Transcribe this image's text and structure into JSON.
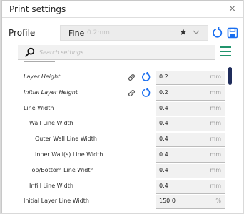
{
  "window": {
    "title": "Print settings",
    "close_symbol": "×"
  },
  "profile": {
    "label": "Profile",
    "selected_name": "Fine",
    "selected_sub": "0.2mm"
  },
  "search": {
    "placeholder": "Search settings",
    "value": ""
  },
  "settings": [
    {
      "label": "Layer Height",
      "italic": true,
      "indent": 0,
      "linked": true,
      "resettable": true,
      "value": "0.2",
      "unit": "mm"
    },
    {
      "label": "Initial Layer Height",
      "italic": true,
      "indent": 0,
      "linked": true,
      "resettable": true,
      "value": "0.2",
      "unit": "mm"
    },
    {
      "label": "Line Width",
      "italic": false,
      "indent": 0,
      "linked": false,
      "resettable": false,
      "value": "0.4",
      "unit": "mm"
    },
    {
      "label": "Wall Line Width",
      "italic": false,
      "indent": 1,
      "linked": false,
      "resettable": false,
      "value": "0.4",
      "unit": "mm"
    },
    {
      "label": "Outer Wall Line Width",
      "italic": false,
      "indent": 2,
      "linked": false,
      "resettable": false,
      "value": "0.4",
      "unit": "mm"
    },
    {
      "label": "Inner Wall(s) Line Width",
      "italic": false,
      "indent": 2,
      "linked": false,
      "resettable": false,
      "value": "0.4",
      "unit": "mm"
    },
    {
      "label": "Top/Bottom Line Width",
      "italic": false,
      "indent": 1,
      "linked": false,
      "resettable": false,
      "value": "0.4",
      "unit": "mm"
    },
    {
      "label": "Infill Line Width",
      "italic": false,
      "indent": 1,
      "linked": false,
      "resettable": false,
      "value": "0.4",
      "unit": "mm"
    },
    {
      "label": "Initial Layer Line Width",
      "italic": false,
      "indent": 0,
      "linked": false,
      "resettable": false,
      "value": "150.0",
      "unit": "%"
    }
  ],
  "colors": {
    "accent": "#196ef0",
    "menu": "#21946c",
    "scrollbar": "#1f2c5b"
  },
  "icons": {
    "close": "close-icon",
    "star": "star-icon",
    "chevron": "chevron-down-icon",
    "reset": "reset-icon",
    "save": "save-icon",
    "search": "search-icon",
    "menu": "menu-icon",
    "link": "link-icon",
    "undo": "undo-icon"
  }
}
